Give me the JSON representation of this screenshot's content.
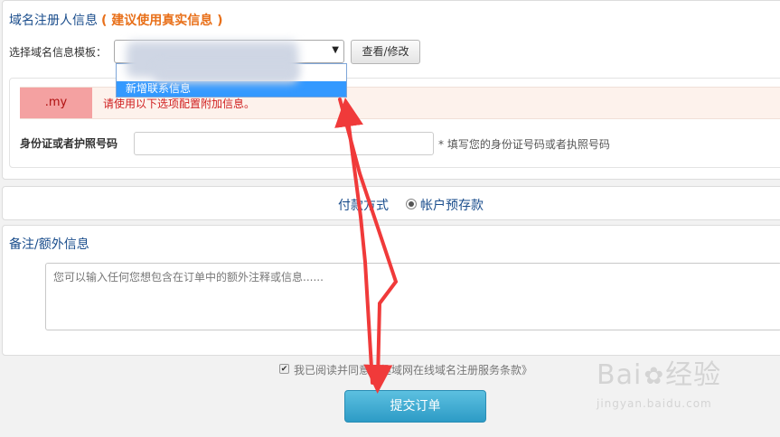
{
  "registrant": {
    "title": "域名注册人信息",
    "title_hint": "( 建议使用真实信息 )",
    "template_label": "选择域名信息模板：",
    "select_value": "",
    "view_edit_button": "查看/修改",
    "dropdown_new_option": "新增联系信息",
    "tld_badge": ".my",
    "notice": "请使用以下选项配置附加信息。",
    "id_label": "身份证或者护照号码",
    "id_value": "",
    "id_hint": "* 填写您的身份证号码或者执照号码"
  },
  "payment": {
    "label": "付款方式",
    "option": "帐户预存款"
  },
  "notes": {
    "title": "备注/额外信息",
    "placeholder": "您可以输入任何您想包含在订单中的额外注释或信息......"
  },
  "agreement": {
    "text": "我已阅读并同意《趣域网在线域名注册服务条款》",
    "checked": true
  },
  "submit_label": "提交订单",
  "watermark": {
    "brand": "Bai",
    "brand_suffix": "经验",
    "url": "jingyan.baidu.com"
  },
  "annotation_color": "#f03a3a",
  "colors": {
    "accent_blue": "#1a4d8c",
    "hint_orange": "#e8701a",
    "submit": "#2d9bc6",
    "selected_option": "#3399ff"
  }
}
